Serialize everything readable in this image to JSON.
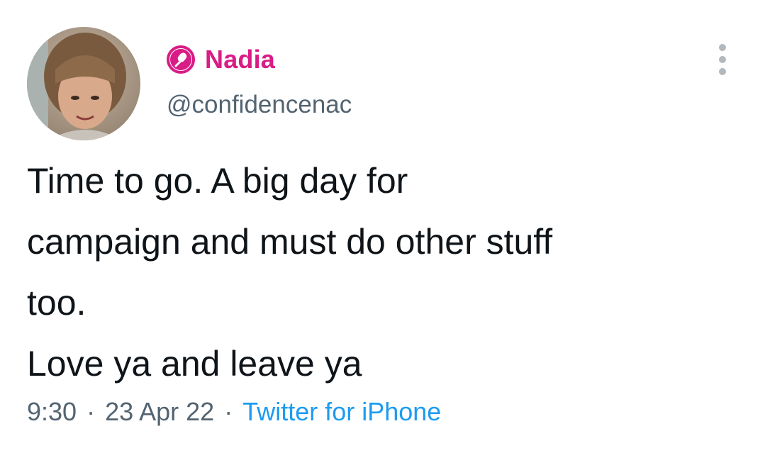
{
  "author": {
    "display_name": "Nadia",
    "handle": "@confidencenac",
    "badge_icon": "microphone-badge-icon",
    "name_color": "#d91c86"
  },
  "tweet": {
    "text": "Time to go. A big day for\ncampaign and must do other stuff\ntoo.\nLove ya and leave ya"
  },
  "meta": {
    "time": "9:30",
    "separator": "·",
    "date": "23 Apr 22",
    "source": "Twitter for iPhone",
    "source_color": "#1d9bf0"
  },
  "icons": {
    "more": "more-vertical-icon"
  }
}
